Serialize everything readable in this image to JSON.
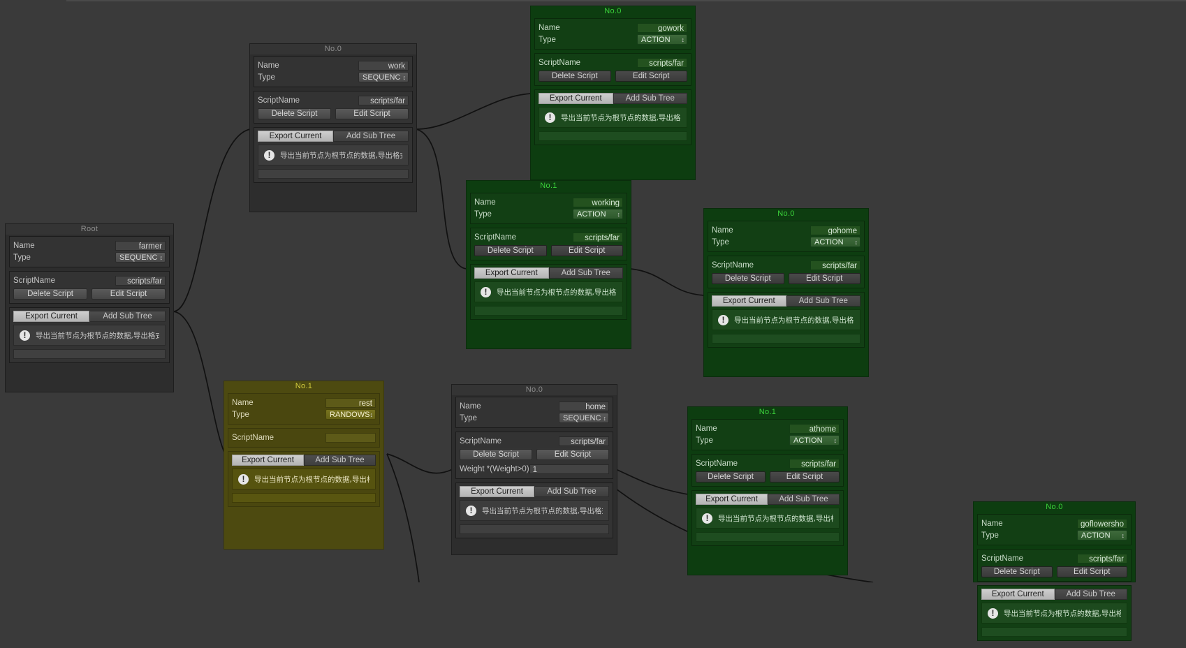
{
  "editor": {
    "background_color": "#3a3a3a",
    "help_text": "导出当前节点为根节点的数据,导出格式xxx",
    "labels": {
      "name": "Name",
      "type": "Type",
      "script_name": "ScriptName",
      "weight": "Weight *(Weight>0)"
    },
    "buttons": {
      "delete_script": "Delete Script",
      "edit_script": "Edit Script"
    },
    "tabs": {
      "export_current": "Export Current",
      "add_sub_tree": "Add Sub Tree"
    },
    "icons": {
      "warning": "!",
      "popup_arrow": "↕"
    }
  },
  "nodes": [
    {
      "id": "root",
      "title": "Root",
      "theme": "dark",
      "name": "farmer",
      "type": "SEQUENC",
      "script_name": "scripts/far",
      "weight": null,
      "has_script_buttons": true,
      "active_tab": "export_current"
    },
    {
      "id": "work",
      "title": "No.0",
      "theme": "dark",
      "name": "work",
      "type": "SEQUENC",
      "script_name": "scripts/far",
      "weight": null,
      "has_script_buttons": true,
      "active_tab": "export_current"
    },
    {
      "id": "gowork",
      "title": "No.0",
      "theme": "green",
      "name": "gowork",
      "type": "ACTION",
      "script_name": "scripts/far",
      "weight": null,
      "has_script_buttons": true,
      "active_tab": "export_current"
    },
    {
      "id": "working",
      "title": "No.1",
      "theme": "green",
      "name": "working",
      "type": "ACTION",
      "script_name": "scripts/far",
      "weight": null,
      "has_script_buttons": true,
      "active_tab": "export_current"
    },
    {
      "id": "gohome",
      "title": "No.0",
      "theme": "green",
      "name": "gohome",
      "type": "ACTION",
      "script_name": "scripts/far",
      "weight": null,
      "has_script_buttons": true,
      "active_tab": "export_current"
    },
    {
      "id": "rest",
      "title": "No.1",
      "theme": "olive",
      "name": "rest",
      "type": "RANDOWS",
      "script_name": "",
      "weight": null,
      "has_script_buttons": false,
      "active_tab": "export_current"
    },
    {
      "id": "home",
      "title": "No.0",
      "theme": "dark",
      "name": "home",
      "type": "SEQUENC",
      "script_name": "scripts/far",
      "weight": "1",
      "has_script_buttons": true,
      "active_tab": "export_current"
    },
    {
      "id": "athome",
      "title": "No.1",
      "theme": "green",
      "name": "athome",
      "type": "ACTION",
      "script_name": "scripts/far",
      "weight": null,
      "has_script_buttons": true,
      "active_tab": "export_current"
    },
    {
      "id": "goflowershop",
      "title": "No.0",
      "theme": "green",
      "name": "goflowersho",
      "type": "ACTION",
      "script_name": "scripts/far",
      "weight": null,
      "has_script_buttons": true,
      "active_tab": "export_current"
    }
  ]
}
